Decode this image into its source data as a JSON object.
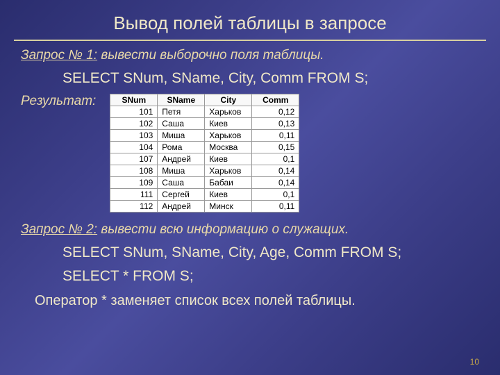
{
  "title": "Вывод полей таблицы в запросе",
  "query1": {
    "label": "Запрос № 1:",
    "desc": " вывести выборочно поля таблицы.",
    "sql": "SELECT SNum, SName, City, Comm FROM  S;"
  },
  "result_label": "Результат:",
  "table": {
    "headers": [
      "SNum",
      "SName",
      "City",
      "Comm"
    ],
    "rows": [
      [
        "101",
        "Петя",
        "Харьков",
        "0,12"
      ],
      [
        "102",
        "Саша",
        "Киев",
        "0,13"
      ],
      [
        "103",
        "Миша",
        "Харьков",
        "0,11"
      ],
      [
        "104",
        "Рома",
        "Москва",
        "0,15"
      ],
      [
        "107",
        "Андрей",
        "Киев",
        "0,1"
      ],
      [
        "108",
        "Миша",
        "Харьков",
        "0,14"
      ],
      [
        "109",
        "Саша",
        "Бабаи",
        "0,14"
      ],
      [
        "111",
        "Сергей",
        "Киев",
        "0,1"
      ],
      [
        "112",
        "Андрей",
        "Минск",
        "0,11"
      ]
    ]
  },
  "query2": {
    "label": "Запрос № 2:",
    "desc": " вывести всю информацию о служащих.",
    "sql1": "SELECT SNum, SName, City, Age, Comm FROM  S;",
    "sql2": "SELECT * FROM  S;"
  },
  "footer": "Оператор  *   заменяет список всех полей таблицы.",
  "page": "10"
}
